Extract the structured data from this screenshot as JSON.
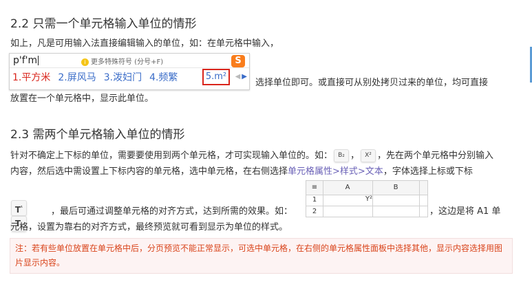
{
  "section1": {
    "heading": "2.2 只需一个单元格输入单位的情形",
    "intro": "如上，凡是可用输入法直接编辑输入的单位，如：在单元格中输入，",
    "ime": {
      "pinyin": "p'f'm",
      "hint_icon": "i",
      "hint": "更多特殊符号 (分号+F)",
      "logo": "S",
      "candidates": [
        "1.平方米",
        "2.屏风马",
        "3.泼妇门",
        "4.频繁"
      ],
      "selected": "5.m²",
      "icons": [
        "left-arrow-icon",
        "right-arrow-icon"
      ]
    },
    "after_ime": "选择单位即可。或直接可从别处拷贝过来的单位，均可直接",
    "line3": "放置在一个单元格中，显示此单位。"
  },
  "section2": {
    "heading": "2.3 需两个单元格输入单位的情形",
    "line1_a": "针对不确定上下标的单位，需要要使用到两个单元格，才可实现输入单位的。如：",
    "chip1": "B₂",
    "chip2": "X²",
    "line1_b": "先在两个单元格中分别输入",
    "line2_a": "内容，然后选中需设置上下标内容的单元格，选中单元格，在右侧选择",
    "line2_link": "单元格属性>样式>文本",
    "line2_b": "，字体选择上标或下标",
    "line3_a": "，最后可通过调整单元格的对齐方式，达到所需的效果。如：",
    "line3_b": "，这边是将 A1 单",
    "line4": "元格，设置为靠右的对齐方式，最终预览就可看到显示为单位的样式。",
    "tt_superscript": "T",
    "tt_superscript_mark": "¹",
    "tt_subscript": "T",
    "tt_subscript_mark": "₁",
    "sheet": {
      "corner": "≡",
      "col_a": "A",
      "col_b": "B",
      "row1": "1",
      "row2": "2",
      "a1": "Y²"
    }
  },
  "note": "注：若有些单位放置在单元格中后，分页预览不能正常显示，可选中单元格，在右侧的单元格属性面板中选择其他，显示内容选择用图片显示内容。",
  "colors": {
    "link": "#6a61b7",
    "note_text": "#d9441b",
    "note_bg": "#fdf3f3",
    "ime_candidate": "#3a6cc8",
    "ime_first": "#d9241b",
    "scroll_thumb": "#5b9bd5"
  }
}
